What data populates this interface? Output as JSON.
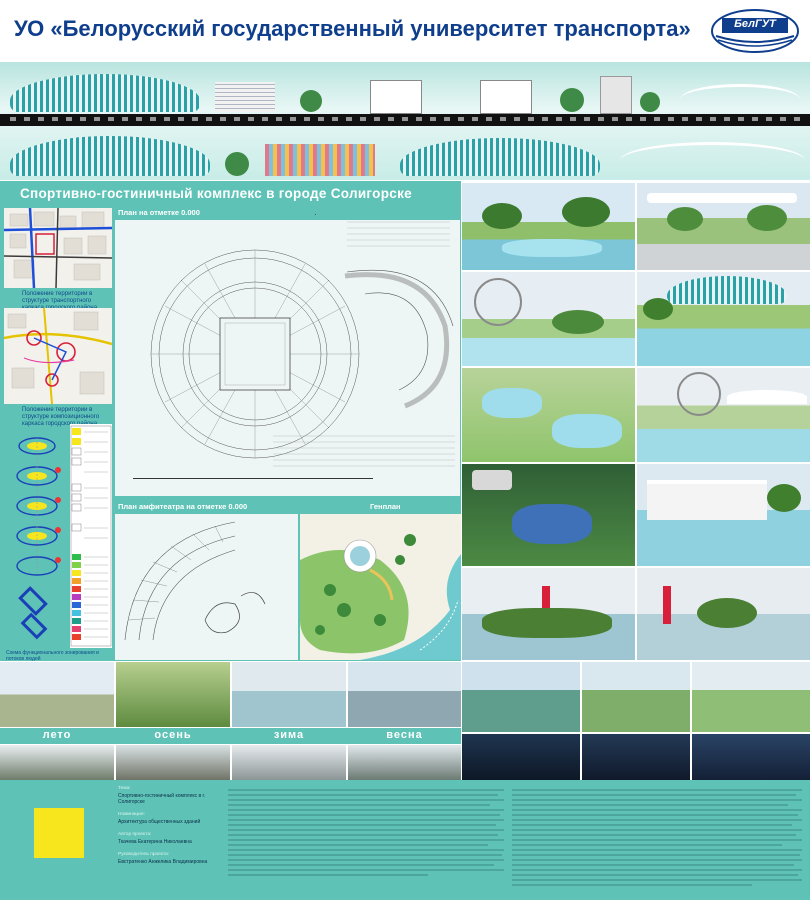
{
  "header": {
    "title": "УО «Белорусский государственный университет транспорта»",
    "logo_text": "БелГУТ"
  },
  "project": {
    "title": "Спортивно-гостиничный комплекс в городе Солигорске"
  },
  "left_column": {
    "map1_caption": "Положение территории в структуре транспортного каркаса городского района",
    "map2_caption": "Положение территории в структуре композиционного каркаса городского района",
    "scheme_caption": "Схема функционального зонирования и потоков людей"
  },
  "plans": {
    "plan_0": "План на отметке 0.000",
    "amphitheatre": "План амфитеатра на отметке 0.000",
    "genplan": "Генплан"
  },
  "seasons": {
    "summer": "лето",
    "autumn": "осень",
    "winter": "зима",
    "spring": "весна"
  },
  "footer": {
    "topic_label": "Тема:",
    "topic_value": "Спортивно-гостиничный комплекс в г. Солигорске",
    "nomination_label": "Номинация:",
    "nomination_value": "Архитектура общественных зданий",
    "author_label": "Автор проекта:",
    "author_value": "Ткачева Екатерина Николаевна",
    "supervisor_label": "Руководитель проекта:",
    "supervisor_value": "Евстратенко Анжелика Владимировна"
  },
  "colors": {
    "header_blue": "#0f3f8c",
    "teal": "#5ec3b6",
    "swatch_yellow": "#f7e51e"
  }
}
